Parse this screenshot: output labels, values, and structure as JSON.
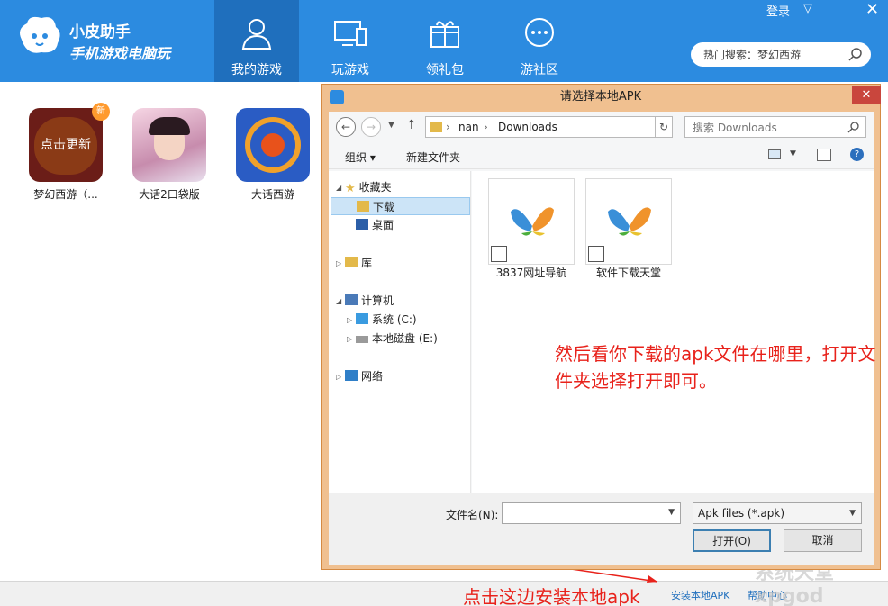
{
  "app": {
    "title": "小皮助手",
    "subtitle": "手机游戏电脑玩"
  },
  "nav": {
    "tabs": [
      "我的游戏",
      "玩游戏",
      "领礼包",
      "游社区"
    ]
  },
  "top": {
    "login": "登录",
    "menu": "▽",
    "close": "✕"
  },
  "search": {
    "placeholder": "热门搜索：梦幻西游"
  },
  "games": [
    {
      "name": "梦幻西游（...",
      "overlay": "点击更新",
      "badge": "新",
      "color": "#6b1d18"
    },
    {
      "name": "大话2口袋版",
      "color": "#d9a8c4"
    },
    {
      "name": "大话西游",
      "color": "#2a5cc4"
    }
  ],
  "dialog": {
    "title": "请选择本地APK",
    "close": "✕",
    "address": {
      "crumbs": [
        "nan",
        "Downloads"
      ],
      "sep": "›"
    },
    "search_placeholder": "搜索 Downloads",
    "toolbar": {
      "organize": "组织 ▾",
      "new_folder": "新建文件夹"
    },
    "nav": {
      "favorites": "收藏夹",
      "downloads": "下载",
      "desktop": "桌面",
      "library": "库",
      "computer": "计算机",
      "drive_c": "系统 (C:)",
      "drive_e": "本地磁盘 (E:)",
      "network": "网络"
    },
    "files": [
      "3837网址导航",
      "软件下载天堂"
    ],
    "filename_label": "文件名(N):",
    "filename_value": "",
    "filter": "Apk files (*.apk)",
    "open": "打开(O)",
    "cancel": "取消"
  },
  "annotations": {
    "main": "然后看你下载的apk文件在哪里，打开文件夹选择打开即可。",
    "bottom": "点击这边安装本地apk"
  },
  "bottom_links": {
    "install": "安装本地APK",
    "help": "帮助中心"
  },
  "watermark": "系统天堂 xpgod"
}
